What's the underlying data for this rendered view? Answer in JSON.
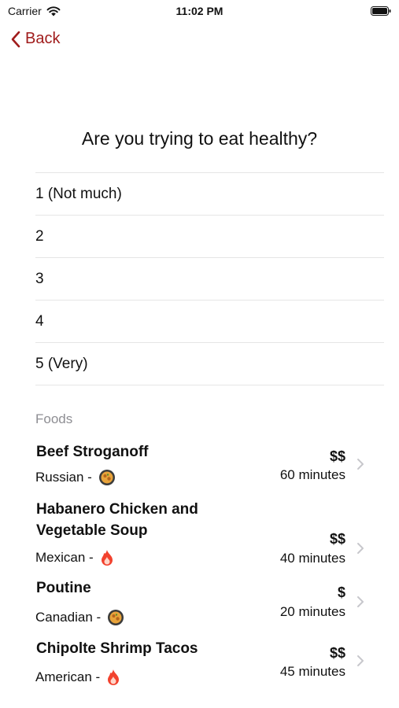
{
  "status_bar": {
    "carrier": "Carrier",
    "time": "11:02 PM"
  },
  "nav": {
    "back_label": "Back"
  },
  "question": "Are you trying to eat healthy?",
  "options": [
    "1 (Not much)",
    "2",
    "3",
    "4",
    "5 (Very)"
  ],
  "section_title": "Foods",
  "foods": [
    {
      "name": "Beef Stroganoff",
      "cuisine": "Russian -",
      "icon": "pan-icon",
      "price": "$$",
      "time": "60 minutes"
    },
    {
      "name": "Habanero Chicken and Vegetable Soup",
      "cuisine": "Mexican -",
      "icon": "fire-icon",
      "price": "$$",
      "time": "40 minutes"
    },
    {
      "name": "Poutine",
      "cuisine": "Canadian -",
      "icon": "pan-icon",
      "price": "$",
      "time": "20 minutes"
    },
    {
      "name": "Chipolte Shrimp Tacos",
      "cuisine": "American -",
      "icon": "fire-icon",
      "price": "$$",
      "time": "45 minutes"
    }
  ],
  "colors": {
    "accent": "#a01c1c",
    "separator": "#e5e5e5",
    "secondary_text": "#8e8e93"
  }
}
